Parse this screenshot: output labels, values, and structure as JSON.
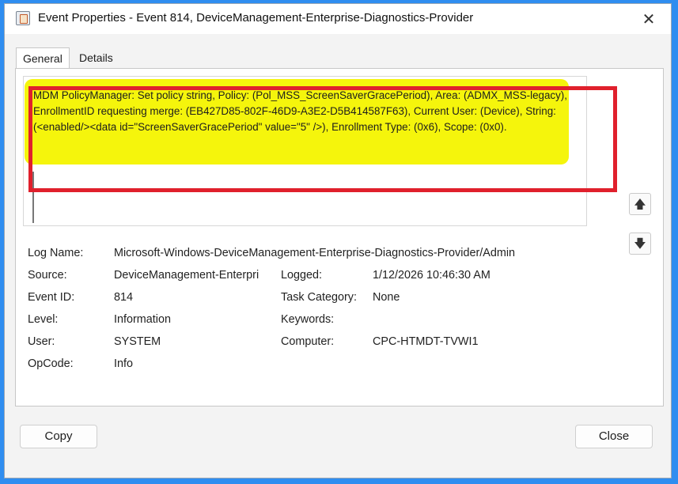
{
  "window": {
    "title": "Event Properties - Event 814, DeviceManagement-Enterprise-Diagnostics-Provider",
    "close_glyph": "✕"
  },
  "tabs": [
    {
      "label": "General",
      "active": true
    },
    {
      "label": "Details",
      "active": false
    }
  ],
  "message": {
    "text": "MDM PolicyManager: Set policy string, Policy: (Pol_MSS_ScreenSaverGracePeriod), Area: (ADMX_MSS-legacy), EnrollmentID requesting merge: (EB427D85-802F-46D9-A3E2-D5B414587F63), Current User: (Device), String: (<enabled/><data id=\"ScreenSaverGracePeriod\" value=\"5\" />), Enrollment Type: (0x6), Scope: (0x0).",
    "highlight_color": "#f5f50c",
    "annotation_color": "#e0202c"
  },
  "nav": {
    "up_icon": "arrow-up-icon",
    "down_icon": "arrow-down-icon",
    "up_glyph": "🡅",
    "down_glyph": "🡇"
  },
  "properties": {
    "log_name": {
      "label": "Log Name:",
      "value": "Microsoft-Windows-DeviceManagement-Enterprise-Diagnostics-Provider/Admin"
    },
    "source": {
      "label": "Source:",
      "value": "DeviceManagement-Enterpri"
    },
    "logged": {
      "label": "Logged:",
      "value": "1/12/2026 10:46:30 AM"
    },
    "event_id": {
      "label": "Event ID:",
      "value": "814"
    },
    "task_category": {
      "label": "Task Category:",
      "value": "None"
    },
    "level": {
      "label": "Level:",
      "value": "Information"
    },
    "keywords": {
      "label": "Keywords:",
      "value": ""
    },
    "user": {
      "label": "User:",
      "value": "SYSTEM"
    },
    "computer": {
      "label": "Computer:",
      "value": "CPC-HTMDT-TVWI1"
    },
    "opcode": {
      "label": "OpCode:",
      "value": "Info"
    }
  },
  "buttons": {
    "copy": "Copy",
    "close": "Close"
  }
}
